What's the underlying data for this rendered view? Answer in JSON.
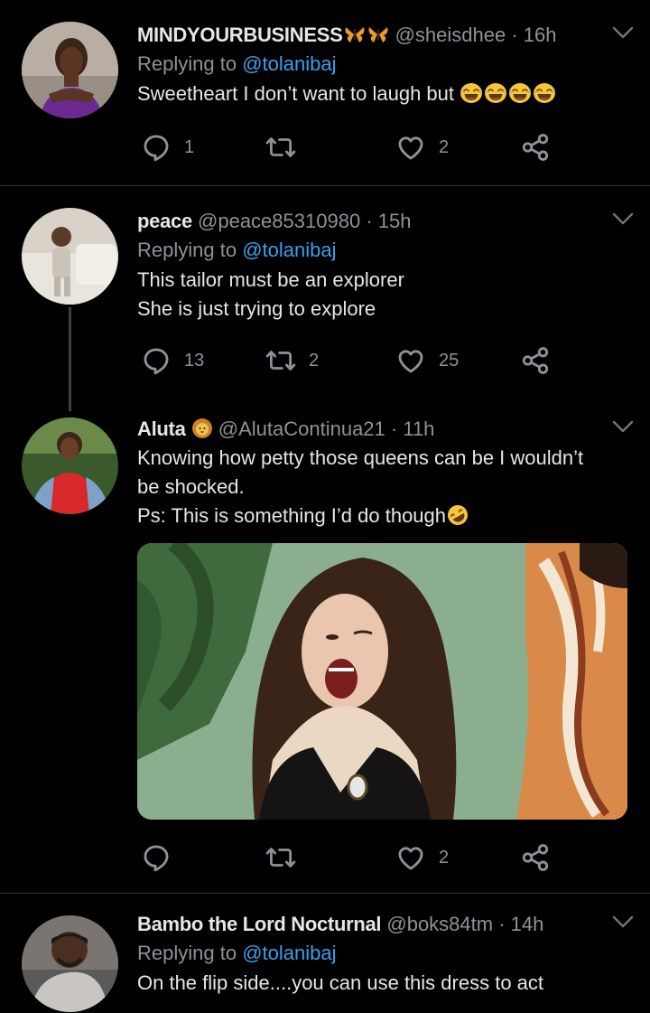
{
  "tweets": [
    {
      "name": "MINDYOURBUSINESS",
      "handle": "@sheisdhee",
      "time": "· 16h",
      "replying_label": "Replying to",
      "replying_to": "@tolanibaj",
      "text_lines": [
        "Sweetheart I don’t want to laugh but"
      ],
      "replies": "1",
      "retweets": "",
      "likes": "2"
    },
    {
      "name": "peace",
      "handle": "@peace85310980",
      "time": "· 15h",
      "replying_label": "Replying to",
      "replying_to": "@tolanibaj",
      "text_lines": [
        "This tailor must be an explorer",
        "She is just trying to explore"
      ],
      "replies": "13",
      "retweets": "2",
      "likes": "25"
    },
    {
      "name": "Aluta",
      "handle": "@AlutaContinua21",
      "time": "· 11h",
      "text_lines": [
        "Knowing how petty those queens can be I wouldn’t",
        "be shocked.",
        "Ps: This is something I’d do though"
      ],
      "replies": "",
      "retweets": "",
      "likes": "2"
    },
    {
      "name": "Bambo the Lord Nocturnal",
      "handle": "@boks84tm",
      "time": "· 14h",
      "replying_label": "Replying to",
      "replying_to": "@tolanibaj",
      "text_lines": [
        "On the flip side....you can use this dress to act"
      ]
    }
  ],
  "icons": {
    "reply": "reply-icon",
    "retweet": "retweet-icon",
    "like": "heart-icon",
    "share": "share-icon",
    "more": "chevron-down-icon"
  },
  "colors": {
    "background": "#000000",
    "link": "#3aa0ef",
    "muted": "#8b9399",
    "text": "#e6e6e6"
  }
}
